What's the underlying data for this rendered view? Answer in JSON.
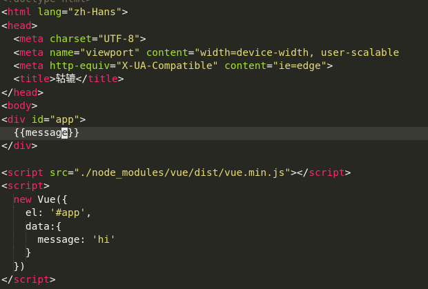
{
  "editor": {
    "colors": {
      "background": "#272822",
      "tag": "#f92672",
      "attribute": "#a6e22e",
      "string": "#e6db74",
      "text": "#f8f8f2",
      "current_line": "#3a3b34"
    },
    "lines": [
      [
        {
          "t": "<!doctype html>",
          "c": "doctype"
        }
      ],
      [
        {
          "t": "<",
          "c": "punct"
        },
        {
          "t": "html",
          "c": "tag"
        },
        {
          "t": " ",
          "c": "text"
        },
        {
          "t": "lang",
          "c": "attr"
        },
        {
          "t": "=",
          "c": "punct"
        },
        {
          "t": "\"zh-Hans\"",
          "c": "str"
        },
        {
          "t": ">",
          "c": "punct"
        }
      ],
      [
        {
          "t": "<",
          "c": "punct"
        },
        {
          "t": "head",
          "c": "tag"
        },
        {
          "t": ">",
          "c": "punct"
        }
      ],
      [
        {
          "t": "  <",
          "c": "punct"
        },
        {
          "t": "meta",
          "c": "tag"
        },
        {
          "t": " ",
          "c": "text"
        },
        {
          "t": "charset",
          "c": "attr"
        },
        {
          "t": "=",
          "c": "punct"
        },
        {
          "t": "\"UTF-8\"",
          "c": "str"
        },
        {
          "t": ">",
          "c": "punct"
        }
      ],
      [
        {
          "t": "  <",
          "c": "punct"
        },
        {
          "t": "meta",
          "c": "tag"
        },
        {
          "t": " ",
          "c": "text"
        },
        {
          "t": "name",
          "c": "attr"
        },
        {
          "t": "=",
          "c": "punct"
        },
        {
          "t": "\"viewport\"",
          "c": "str"
        },
        {
          "t": " ",
          "c": "text"
        },
        {
          "t": "content",
          "c": "attr"
        },
        {
          "t": "=",
          "c": "punct"
        },
        {
          "t": "\"width=device-width, user-scalable",
          "c": "str"
        }
      ],
      [
        {
          "t": "  <",
          "c": "punct"
        },
        {
          "t": "meta",
          "c": "tag"
        },
        {
          "t": " ",
          "c": "text"
        },
        {
          "t": "http-equiv",
          "c": "attr"
        },
        {
          "t": "=",
          "c": "punct"
        },
        {
          "t": "\"X-UA-Compatible\"",
          "c": "str"
        },
        {
          "t": " ",
          "c": "text"
        },
        {
          "t": "content",
          "c": "attr"
        },
        {
          "t": "=",
          "c": "punct"
        },
        {
          "t": "\"ie=edge\"",
          "c": "str"
        },
        {
          "t": ">",
          "c": "punct"
        }
      ],
      [
        {
          "t": "  <",
          "c": "punct"
        },
        {
          "t": "title",
          "c": "tag"
        },
        {
          "t": ">",
          "c": "punct"
        },
        {
          "t": "轱辘",
          "c": "text"
        },
        {
          "t": "</",
          "c": "punct"
        },
        {
          "t": "title",
          "c": "tag"
        },
        {
          "t": ">",
          "c": "punct"
        }
      ],
      [
        {
          "t": "</",
          "c": "punct"
        },
        {
          "t": "head",
          "c": "tag"
        },
        {
          "t": ">",
          "c": "punct"
        }
      ],
      [
        {
          "t": "<",
          "c": "punct"
        },
        {
          "t": "body",
          "c": "tag"
        },
        {
          "t": ">",
          "c": "punct"
        }
      ],
      [
        {
          "t": "<",
          "c": "punct"
        },
        {
          "t": "div",
          "c": "tag"
        },
        {
          "t": " ",
          "c": "text"
        },
        {
          "t": "id",
          "c": "attr"
        },
        {
          "t": "=",
          "c": "punct"
        },
        {
          "t": "\"app\"",
          "c": "str"
        },
        {
          "t": ">",
          "c": "punct"
        }
      ],
      [
        {
          "t": "  {{messag",
          "c": "text"
        },
        {
          "t": "e",
          "c": "cursor"
        },
        {
          "t": "}}",
          "c": "text"
        }
      ],
      [
        {
          "t": "</",
          "c": "punct"
        },
        {
          "t": "div",
          "c": "tag"
        },
        {
          "t": ">",
          "c": "punct"
        }
      ],
      [],
      [
        {
          "t": "<",
          "c": "punct"
        },
        {
          "t": "script",
          "c": "tag"
        },
        {
          "t": " ",
          "c": "text"
        },
        {
          "t": "src",
          "c": "attr"
        },
        {
          "t": "=",
          "c": "punct"
        },
        {
          "t": "\"./node_modules/vue/dist/vue.min.js\"",
          "c": "str"
        },
        {
          "t": "></",
          "c": "punct"
        },
        {
          "t": "script",
          "c": "tag"
        },
        {
          "t": ">",
          "c": "punct"
        }
      ],
      [
        {
          "t": "<",
          "c": "punct"
        },
        {
          "t": "script",
          "c": "tag"
        },
        {
          "t": ">",
          "c": "punct"
        }
      ],
      [
        {
          "t": "  ",
          "c": "text"
        },
        {
          "t": "new",
          "c": "kw"
        },
        {
          "t": " Vue({",
          "c": "fn"
        }
      ],
      [
        {
          "t": "    el: ",
          "c": "text"
        },
        {
          "t": "'#app'",
          "c": "str"
        },
        {
          "t": ",",
          "c": "punct"
        }
      ],
      [
        {
          "t": "    data:{",
          "c": "text"
        }
      ],
      [
        {
          "t": "      message: ",
          "c": "text"
        },
        {
          "t": "'hi'",
          "c": "str"
        }
      ],
      [
        {
          "t": "    }",
          "c": "text"
        }
      ],
      [
        {
          "t": "  })",
          "c": "text"
        }
      ],
      [
        {
          "t": "</",
          "c": "punct"
        },
        {
          "t": "script",
          "c": "tag"
        },
        {
          "t": ">",
          "c": "punct"
        }
      ]
    ],
    "current_line_index": 10
  }
}
